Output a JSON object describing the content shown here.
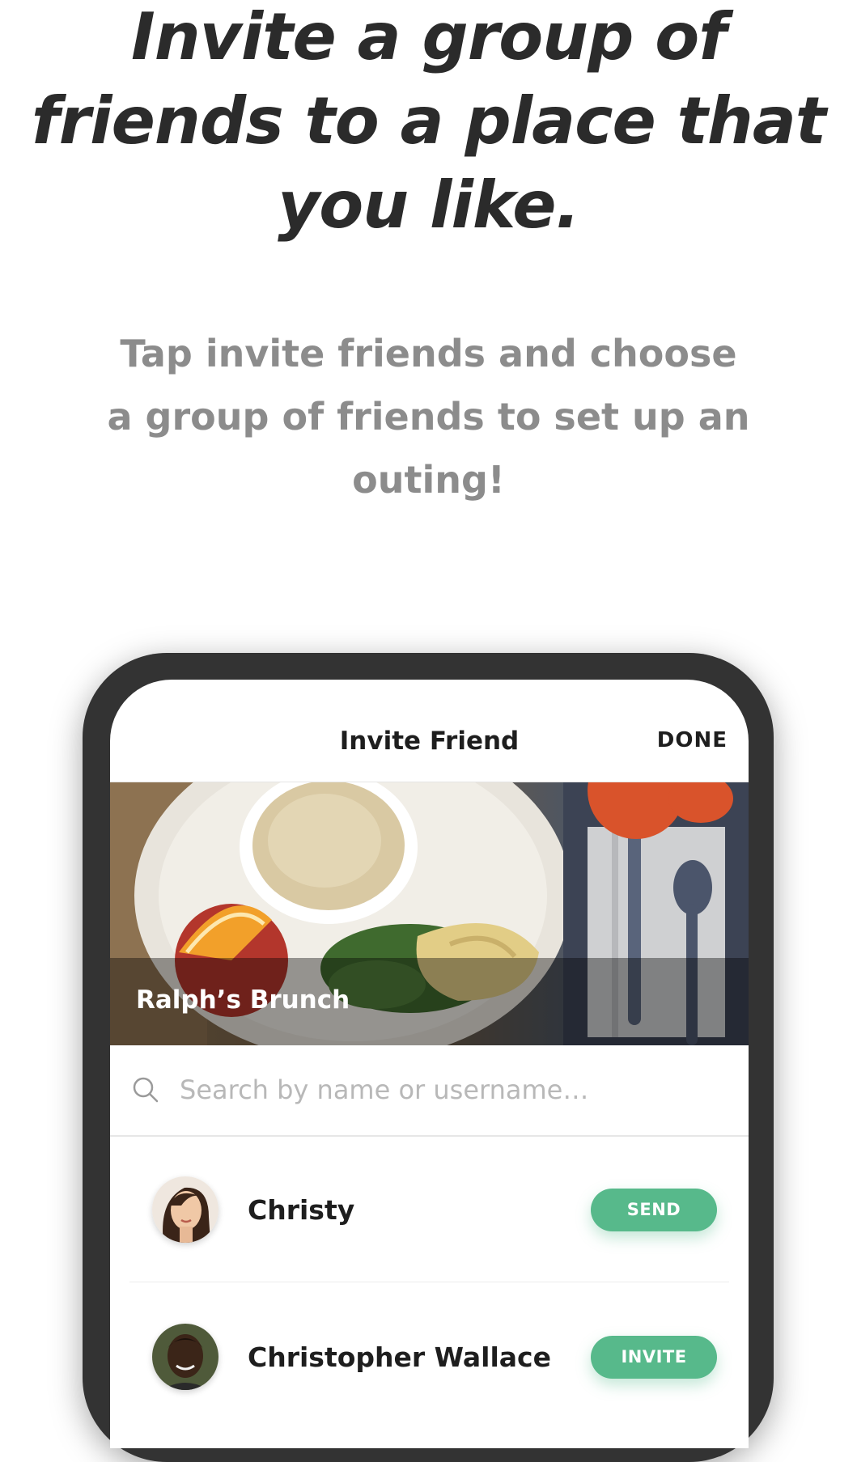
{
  "headline": [
    "Invite a group of",
    "friends to a place that",
    "you like."
  ],
  "subheadline": [
    "Tap invite friends and choose",
    "a group of friends to set up an",
    "outing!"
  ],
  "screen": {
    "title": "Invite Friend",
    "done_label": "DONE",
    "place_name": "Ralph’s Brunch",
    "search_placeholder": "Search by name or username…",
    "friends": [
      {
        "name": "Christy",
        "action": "SEND"
      },
      {
        "name": "Christopher Wallace",
        "action": "INVITE"
      }
    ]
  },
  "colors": {
    "accent": "#57b98b",
    "headline": "#2b2b2b",
    "subheadline": "#8c8c8c",
    "phone_frame": "#333333"
  }
}
